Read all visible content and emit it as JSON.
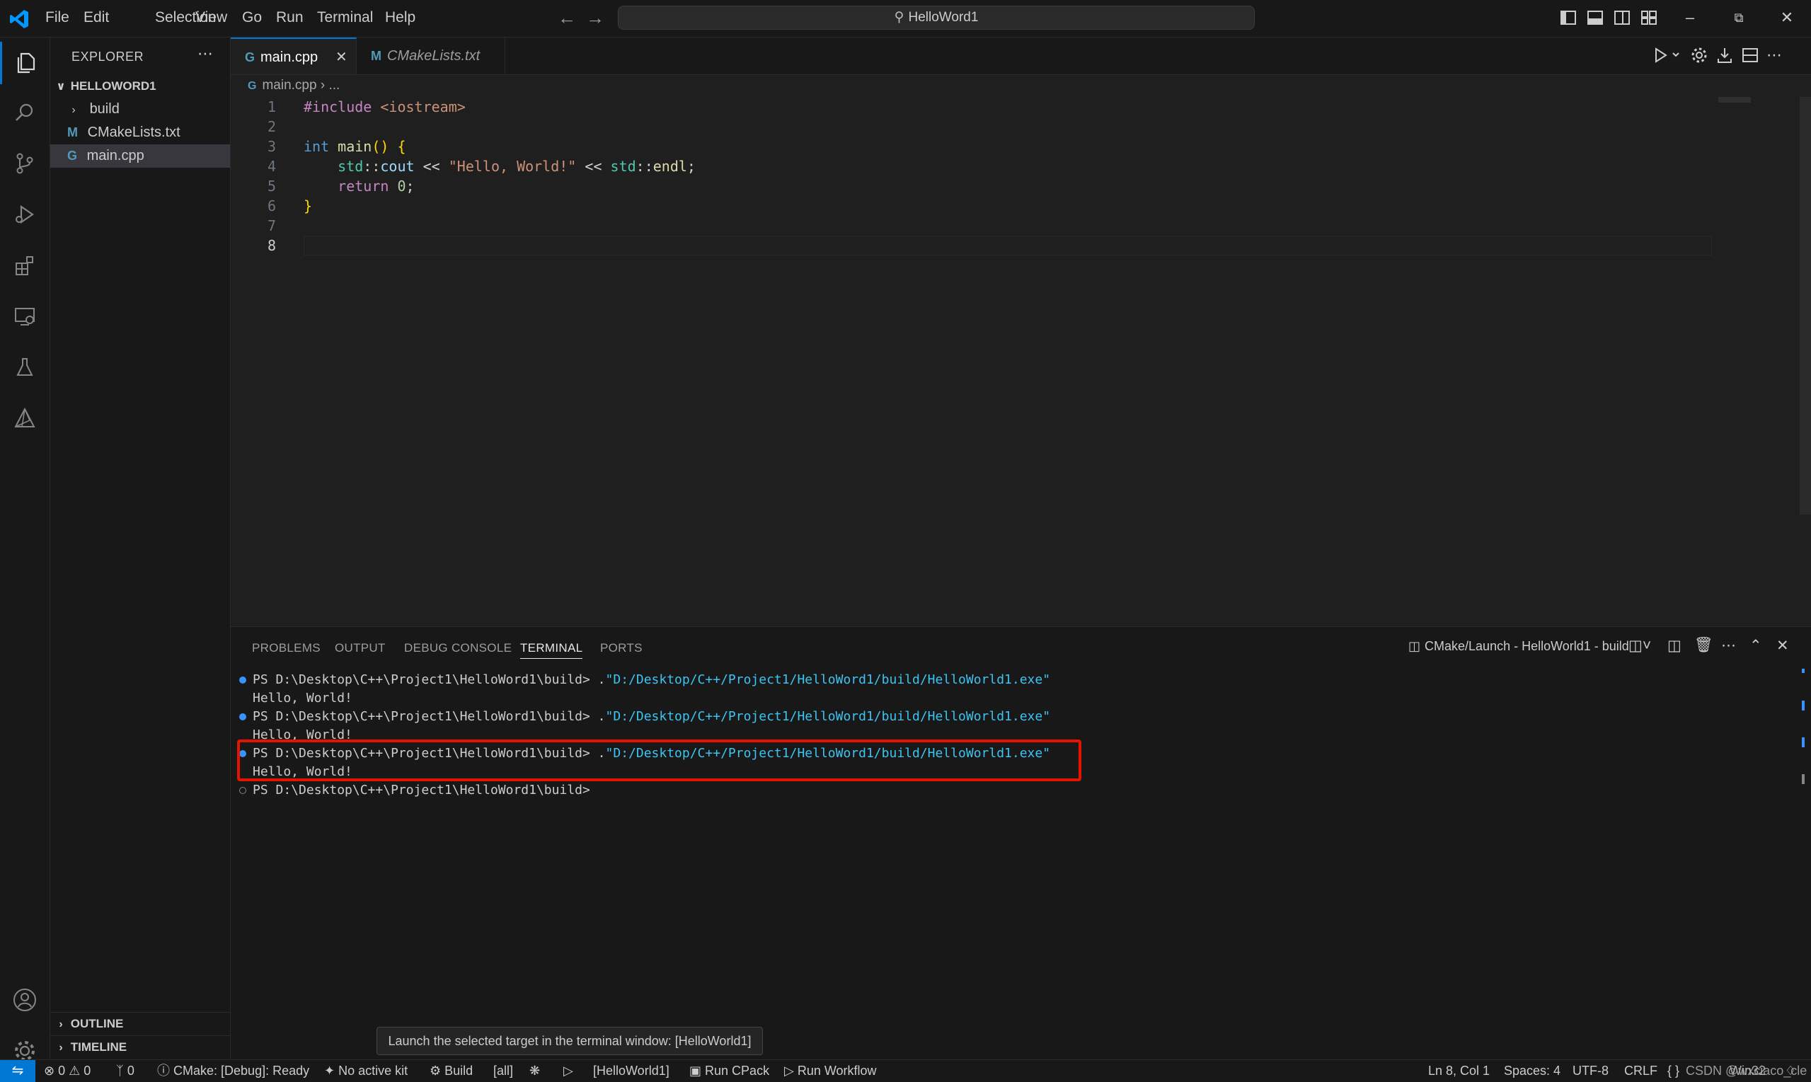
{
  "title_bar": {
    "menus": [
      "File",
      "Edit",
      "Selection",
      "View",
      "Go",
      "Run",
      "Terminal",
      "Help"
    ],
    "command_center": "HelloWord1"
  },
  "explorer": {
    "title": "EXPLORER",
    "project": "HELLOWORD1",
    "items": [
      {
        "label": "build",
        "type": "folder"
      },
      {
        "label": "CMakeLists.txt",
        "type": "cmake"
      },
      {
        "label": "main.cpp",
        "type": "cpp"
      }
    ],
    "outline": "OUTLINE",
    "timeline": "TIMELINE"
  },
  "tabs": [
    {
      "label": "main.cpp"
    },
    {
      "label": "CMakeLists.txt"
    }
  ],
  "breadcrumb": {
    "file": "main.cpp",
    "rest": "..."
  },
  "code": {
    "line_numbers": [
      "1",
      "2",
      "3",
      "4",
      "5",
      "6",
      "7",
      "8"
    ],
    "l1_include": "#include",
    "l1_header": "<iostream>",
    "l3_int": "int",
    "l3_main": "main",
    "l3_rest": "() ",
    "l3_brace": "{",
    "l4_std": "std",
    "l4_sep": "::",
    "l4_cout": "cout",
    "l4_op1": " << ",
    "l4_str": "\"Hello, World!\"",
    "l4_op2": " << ",
    "l4_std2": "std",
    "l4_sep2": "::",
    "l4_endl": "endl",
    "l4_semi": ";",
    "l5_return": "return",
    "l5_zero": "0",
    "l5_semi": ";",
    "l6_brace": "}"
  },
  "panel": {
    "tabs": [
      "PROBLEMS",
      "OUTPUT",
      "DEBUG CONSOLE",
      "TERMINAL",
      "PORTS"
    ],
    "active_tab": "TERMINAL",
    "terminal_title": "CMake/Launch - HelloWorld1 - build",
    "prompt": "PS D:\\Desktop\\C++\\Project1\\HelloWord1\\build> ",
    "run_prefix": ".",
    "exe_path": "\"D:/Desktop/C++/Project1/HelloWord1/build/HelloWorld1.exe\"",
    "output": "Hello, World!",
    "final_prompt": "PS D:\\Desktop\\C++\\Project1\\HelloWord1\\build> "
  },
  "tooltip": "Launch the selected target in the terminal window: [HelloWorld1]",
  "status_bar": {
    "errors": "0",
    "warnings": "0",
    "ports": "0",
    "cmake_status": "CMake: [Debug]: Ready",
    "kit": "No active kit",
    "build": "Build",
    "target_all": "[all]",
    "launch_target": "[HelloWorld1]",
    "run_cpack": "Run CPack",
    "run_workflow": "Run Workflow",
    "cursor": "Ln 8, Col 1",
    "spaces": "Spaces: 4",
    "encoding": "UTF-8",
    "eol": "CRLF",
    "language_braces": "{ }",
    "platform": "Win32",
    "watermark": "CSDN @wxciaco_cle"
  },
  "colors": {
    "accent": "#0078d4",
    "highlight_box": "#e51400",
    "terminal_path": "#3cc4f2"
  }
}
